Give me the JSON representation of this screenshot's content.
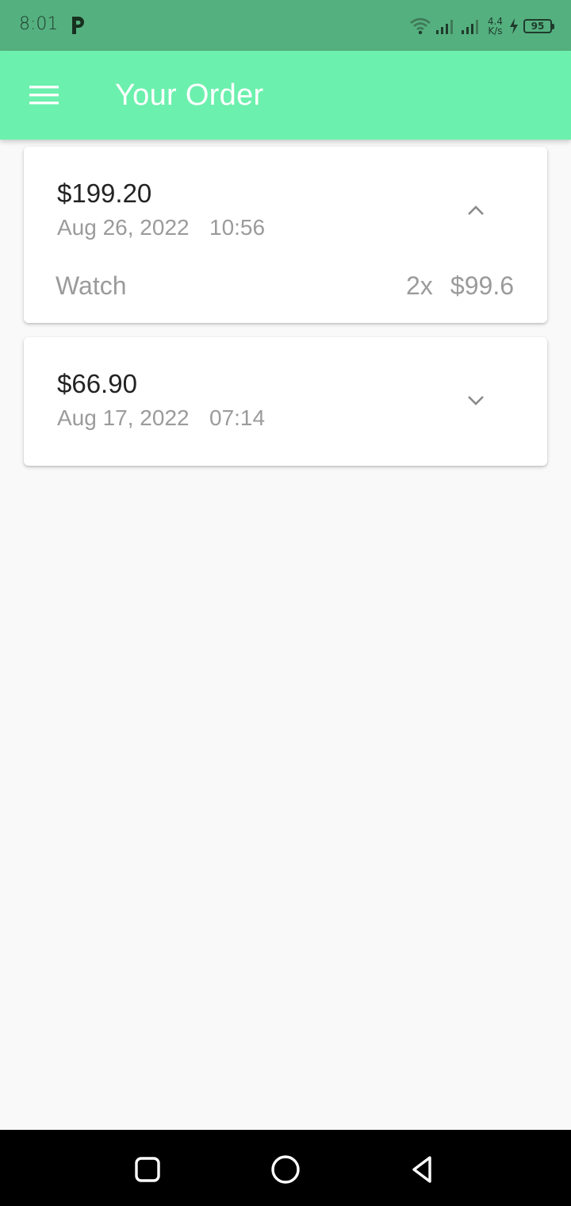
{
  "status_bar": {
    "time": "8:01",
    "net_speed_value": "4.4",
    "net_speed_unit": "K/s",
    "battery_level": "95"
  },
  "app_bar": {
    "title": "Your Order",
    "menu_icon": "hamburger-menu-icon"
  },
  "orders": [
    {
      "total": "$199.20",
      "date": "Aug 26, 2022",
      "time": "10:56",
      "expanded": true,
      "toggle_icon": "chevron-up-icon",
      "items": [
        {
          "name": "Watch",
          "quantity": "2x",
          "price": "$99.6"
        }
      ]
    },
    {
      "total": "$66.90",
      "date": "Aug 17, 2022",
      "time": "07:14",
      "expanded": false,
      "toggle_icon": "chevron-down-icon",
      "items": []
    }
  ],
  "colors": {
    "status_bar": "#55b07f",
    "app_bar": "#6cf0ad",
    "background": "#f9f9f9",
    "primary_text": "#232323",
    "secondary_text": "#9b9b9b"
  }
}
